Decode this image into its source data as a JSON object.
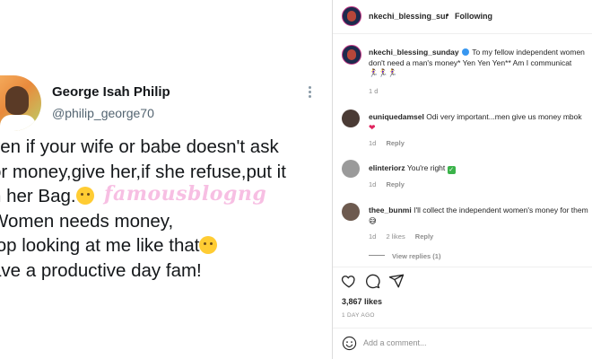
{
  "tweet": {
    "author_name": "George Isah Philip",
    "author_handle": "@philip_george70",
    "lines": [
      "ven if your wife or babe doesn't ask",
      "or money,give her,if she refuse,put it",
      "n her Bag.",
      "Women needs money,",
      "top looking at me like that",
      "ave a productive day fam!"
    ],
    "watermark": "famousblogng"
  },
  "instagram": {
    "header": {
      "username": "nkechi_blessing_sur",
      "separator": "•",
      "follow_status": "Following"
    },
    "caption": {
      "username": "nkechi_blessing_sunday",
      "text": "To my fellow independent women don't need a man's money* Yen Yen Yen** Am I communicat",
      "emojis": "🏃‍♀️🏃‍♀️🏃‍♀️",
      "time": "1 d"
    },
    "comments": [
      {
        "username": "euniquedamsel",
        "text": "Odi very important...men give us money mbok",
        "time": "1d",
        "reply": "Reply",
        "avatar_color": "#4a3b35"
      },
      {
        "username": "elinteriorz",
        "text": "You're right",
        "time": "1d",
        "reply": "Reply",
        "avatar_color": "#9a9a9a"
      },
      {
        "username": "thee_bunmi",
        "text": "I'll collect the independent women's money for them",
        "time": "1d",
        "likes": "2 likes",
        "reply": "Reply",
        "avatar_color": "#6d5a4f"
      }
    ],
    "view_replies": "View replies (1)",
    "likes": "3,867 likes",
    "date": "1 DAY AGO",
    "add_comment_placeholder": "Add a comment...",
    "colors": {
      "accent_blue": "#3897f0",
      "heart_red": "#e0245e",
      "meta_gray": "#8e8e8e"
    }
  }
}
